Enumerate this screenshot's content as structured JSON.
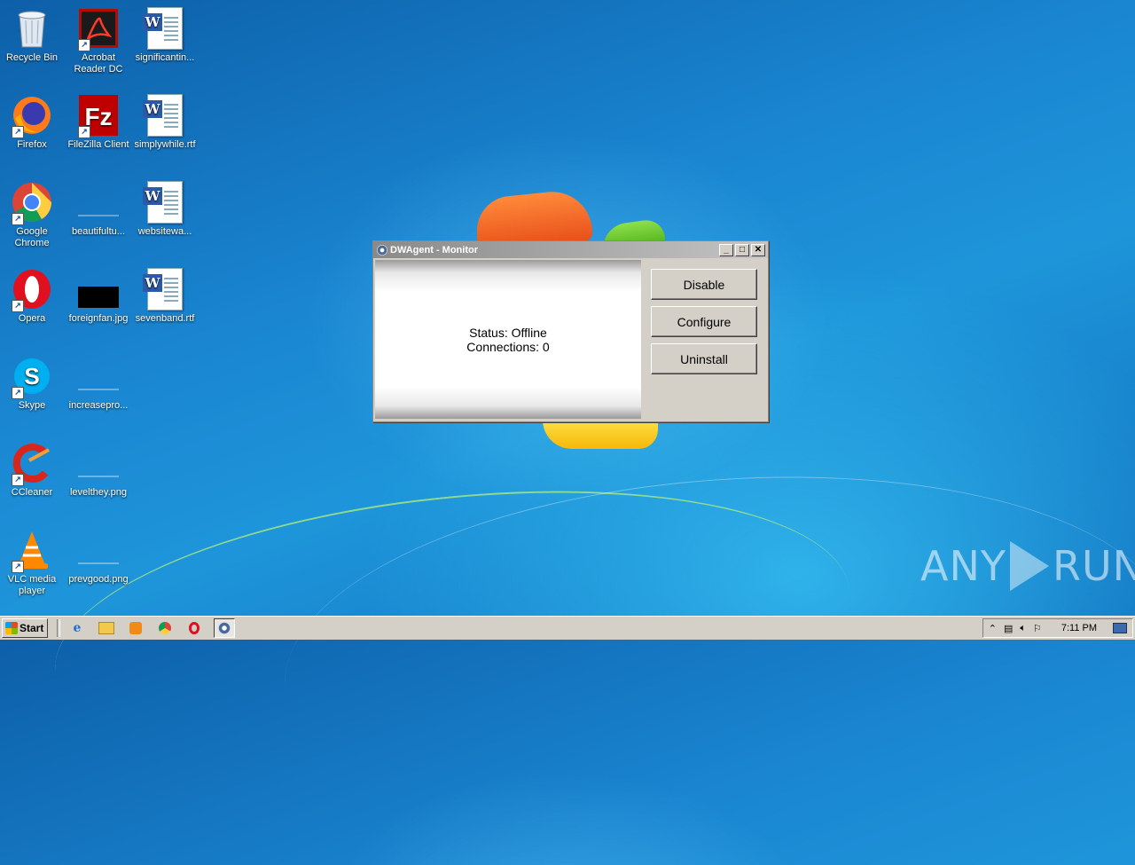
{
  "desktop": {
    "icons": [
      {
        "label": "Recycle Bin",
        "icon": "recycle-bin-icon"
      },
      {
        "label": "Acrobat Reader DC",
        "icon": "acrobat-reader-icon"
      },
      {
        "label": "significantin...",
        "icon": "word-document-icon"
      },
      {
        "label": "Firefox",
        "icon": "firefox-icon"
      },
      {
        "label": "FileZilla Client",
        "icon": "filezilla-icon"
      },
      {
        "label": "simplywhile.rtf",
        "icon": "word-document-icon"
      },
      {
        "label": "Google Chrome",
        "icon": "chrome-icon"
      },
      {
        "label": "beautifultu...",
        "icon": "image-file-icon"
      },
      {
        "label": "websitewa...",
        "icon": "word-document-icon"
      },
      {
        "label": "Opera",
        "icon": "opera-icon"
      },
      {
        "label": "foreignfan.jpg",
        "icon": "image-file-icon"
      },
      {
        "label": "sevenband.rtf",
        "icon": "word-document-icon"
      },
      {
        "label": "Skype",
        "icon": "skype-icon"
      },
      {
        "label": "increasepro...",
        "icon": "image-file-icon"
      },
      {
        "label": "CCleaner",
        "icon": "ccleaner-icon"
      },
      {
        "label": "levelthey.png",
        "icon": "image-file-icon"
      },
      {
        "label": "VLC media player",
        "icon": "vlc-icon"
      },
      {
        "label": "prevgood.png",
        "icon": "image-file-icon"
      }
    ]
  },
  "window": {
    "title": "DWAgent - Monitor",
    "status_text": "Status: Offline",
    "connections_text": "Connections: 0",
    "buttons": {
      "disable": "Disable",
      "configure": "Configure",
      "uninstall": "Uninstall"
    },
    "controls": {
      "minimize": "_",
      "maximize": "□",
      "close": "✕"
    }
  },
  "taskbar": {
    "start_label": "Start",
    "quick_launch": [
      "internet-explorer-icon",
      "folder-icon",
      "media-player-icon",
      "chrome-icon",
      "opera-icon",
      "dwagent-icon"
    ],
    "tray": {
      "clock": "7:11 PM"
    }
  },
  "watermark": {
    "left": "ANY",
    "right": "RUN"
  },
  "colors": {
    "desktop_blue": "#1a86d2",
    "window_face": "#d4d0c8",
    "titlebar_gray": "#8a8a8a"
  }
}
